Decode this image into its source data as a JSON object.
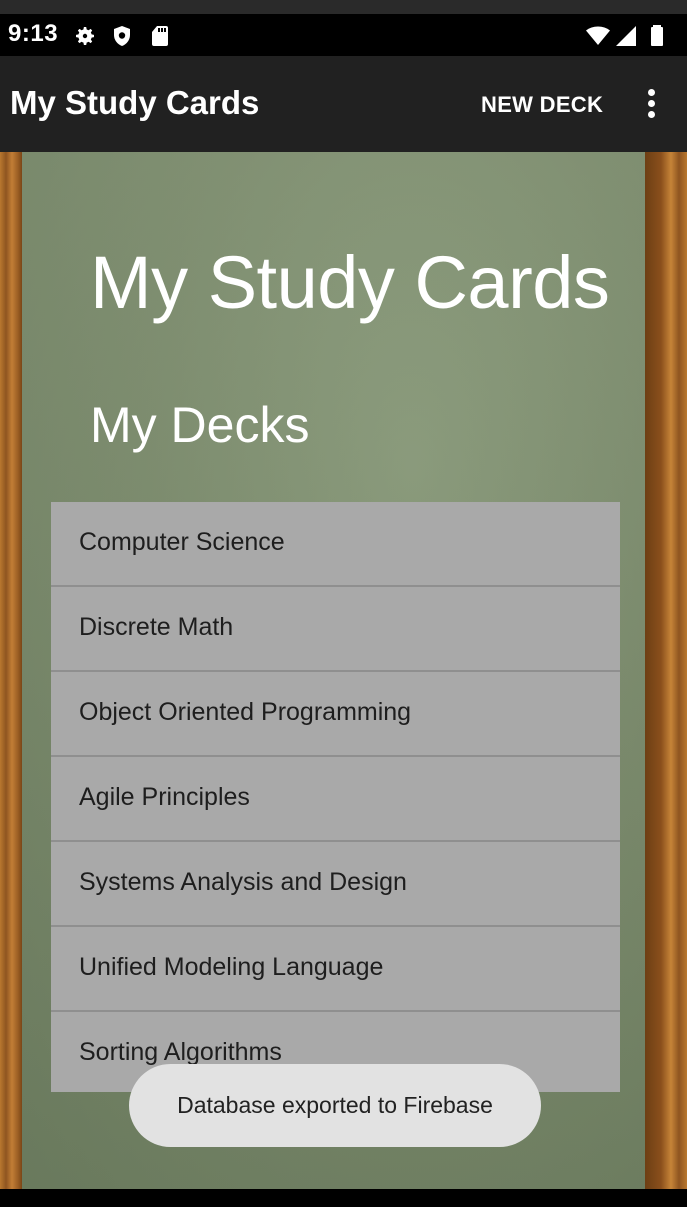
{
  "status_bar": {
    "time": "9:13",
    "icons": [
      "gear-icon",
      "shield-icon",
      "sd-card-icon",
      "wifi-icon",
      "signal-icon",
      "battery-icon"
    ]
  },
  "app_bar": {
    "title": "My Study Cards",
    "new_deck_label": "NEW DECK",
    "overflow_icon": "more-vert-icon"
  },
  "main": {
    "heading": "My Study Cards",
    "subheading": "My Decks",
    "decks": [
      {
        "label": "Computer Science"
      },
      {
        "label": "Discrete Math"
      },
      {
        "label": "Object Oriented Programming"
      },
      {
        "label": "Agile Principles"
      },
      {
        "label": "Systems Analysis and Design"
      },
      {
        "label": "Unified Modeling Language"
      },
      {
        "label": "Sorting Algorithms"
      }
    ]
  },
  "toast": {
    "message": "Database exported to Firebase"
  },
  "colors": {
    "app_bar": "#212121",
    "chalkboard": "#7b8b6c",
    "wood": "#b9782f",
    "list_bg": "#a9a9a9",
    "toast_bg": "#e2e2e2"
  }
}
